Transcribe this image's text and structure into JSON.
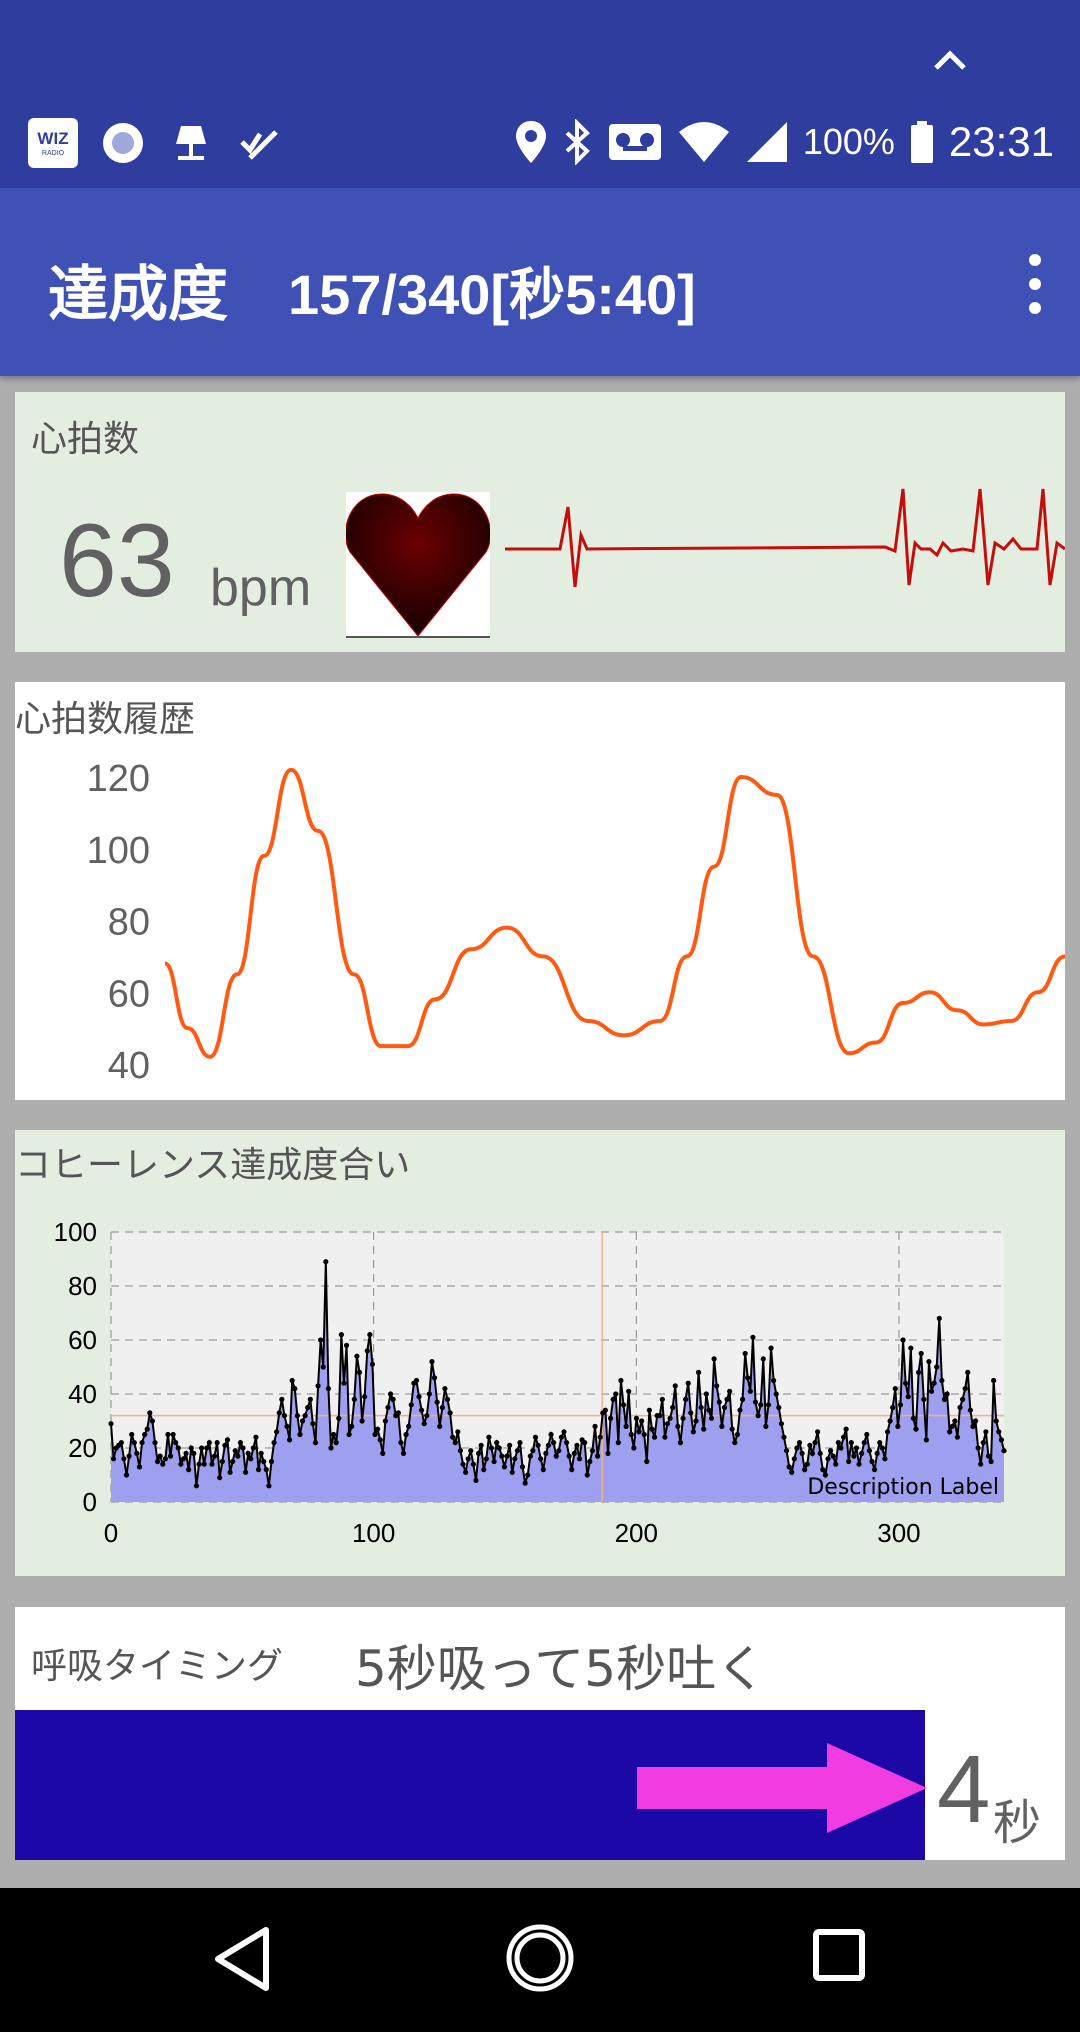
{
  "status_bar": {
    "left_icons": [
      "wiz-radio-icon",
      "record-icon",
      "lamp-icon",
      "checklist-icon"
    ],
    "wiz_label": "WIZ",
    "wiz_sub": "RADIO",
    "right_icons": [
      "location-icon",
      "bluetooth-icon",
      "voicemail-icon",
      "wifi-icon",
      "signal-icon",
      "battery-icon"
    ],
    "battery": "100%",
    "time": "23:31"
  },
  "app_bar": {
    "title": "達成度",
    "progress": "157/340[秒5:40]",
    "menu_icon": "more-vert-icon"
  },
  "heart_rate": {
    "label": "心拍数",
    "value": "63",
    "unit": "bpm"
  },
  "hr_history": {
    "label": "心拍数履歴"
  },
  "coherence": {
    "label": "コヒーレンス達成度合い",
    "description": "Description Label"
  },
  "breathing": {
    "label": "呼吸タイミング",
    "instruction": "5秒吸って5秒吐く",
    "seconds": "4",
    "unit": "秒"
  },
  "nav_bar": {
    "icons": [
      "back-icon",
      "home-icon",
      "recents-icon"
    ]
  },
  "chart_data": [
    {
      "type": "line",
      "series_color": "#ff5a12",
      "y_ticks": [
        120,
        100,
        80,
        60,
        40
      ],
      "ylim": [
        40,
        120
      ],
      "xlim": [
        0,
        100
      ],
      "grid": false,
      "x": [
        0,
        2.5,
        5,
        8,
        11,
        14,
        17,
        21,
        24,
        27,
        30,
        34,
        38,
        42,
        47,
        51,
        55,
        58,
        61,
        64,
        68,
        72,
        76,
        79,
        82,
        85,
        88,
        91,
        94,
        97,
        100
      ],
      "y": [
        68,
        50,
        42,
        65,
        98,
        122,
        105,
        65,
        45,
        45,
        58,
        72,
        78,
        70,
        52,
        48,
        52,
        70,
        95,
        120,
        115,
        70,
        43,
        46,
        57,
        60,
        55,
        51,
        52,
        60,
        70
      ]
    },
    {
      "type": "area",
      "series_color": "#9f9ff0",
      "line_color": "#000000",
      "x_ticks": [
        0,
        100,
        200,
        300
      ],
      "y_ticks": [
        0,
        20,
        40,
        60,
        80,
        100
      ],
      "xlim": [
        0,
        340
      ],
      "ylim": [
        0,
        100
      ],
      "grid": true,
      "reference": {
        "x": 187,
        "y": 32,
        "color": "#f4b183"
      },
      "y": [
        29,
        16,
        20,
        21,
        22,
        16,
        10,
        17,
        25,
        22,
        18,
        13,
        22,
        25,
        27,
        33,
        30,
        22,
        15,
        17,
        14,
        16,
        25,
        17,
        25,
        22,
        20,
        14,
        16,
        18,
        12,
        20,
        18,
        6,
        14,
        20,
        14,
        20,
        22,
        14,
        17,
        22,
        9,
        15,
        21,
        23,
        11,
        15,
        19,
        17,
        22,
        20,
        11,
        18,
        16,
        20,
        24,
        12,
        18,
        15,
        12,
        6,
        15,
        22,
        26,
        33,
        38,
        32,
        28,
        23,
        45,
        42,
        32,
        25,
        30,
        32,
        35,
        38,
        29,
        22,
        43,
        60,
        50,
        89,
        42,
        20,
        25,
        22,
        31,
        62,
        44,
        58,
        25,
        28,
        38,
        54,
        48,
        30,
        39,
        56,
        62,
        51,
        25,
        27,
        23,
        18,
        30,
        35,
        40,
        38,
        32,
        33,
        22,
        18,
        25,
        28,
        36,
        44,
        45,
        39,
        34,
        29,
        32,
        40,
        52,
        46,
        37,
        28,
        35,
        42,
        38,
        33,
        24,
        22,
        26,
        19,
        14,
        11,
        16,
        19,
        14,
        8,
        18,
        21,
        12,
        16,
        24,
        20,
        15,
        22,
        20,
        17,
        13,
        17,
        21,
        11,
        16,
        19,
        22,
        13,
        7,
        10,
        17,
        19,
        24,
        21,
        16,
        12,
        18,
        21,
        25,
        22,
        17,
        19,
        24,
        26,
        22,
        17,
        12,
        18,
        21,
        16,
        23,
        22,
        10,
        15,
        19,
        28,
        17,
        24,
        33,
        34,
        18,
        31,
        38,
        40,
        22,
        45,
        36,
        28,
        41,
        25,
        20,
        31,
        26,
        30,
        25,
        15,
        34,
        27,
        24,
        32,
        32,
        38,
        24,
        29,
        31,
        35,
        43,
        28,
        22,
        31,
        38,
        44,
        33,
        26,
        30,
        48,
        35,
        27,
        40,
        34,
        31,
        53,
        43,
        37,
        28,
        35,
        38,
        41,
        27,
        22,
        25,
        34,
        38,
        55,
        46,
        41,
        61,
        37,
        32,
        36,
        53,
        28,
        36,
        57,
        45,
        40,
        35,
        29,
        24,
        19,
        13,
        11,
        16,
        20,
        22,
        18,
        12,
        14,
        21,
        18,
        22,
        26,
        18,
        12,
        10,
        16,
        19,
        17,
        14,
        22,
        20,
        24,
        27,
        15,
        22,
        17,
        20,
        14,
        18,
        22,
        25,
        19,
        15,
        12,
        18,
        22,
        20,
        16,
        26,
        30,
        35,
        42,
        28,
        36,
        60,
        44,
        39,
        57,
        31,
        27,
        48,
        55,
        38,
        23,
        52,
        41,
        44,
        50,
        68,
        45,
        38,
        40,
        26,
        28,
        30,
        24,
        35,
        38,
        42,
        48,
        34,
        28,
        30,
        20,
        14,
        22,
        26,
        17,
        15,
        45,
        30,
        26,
        23,
        19
      ]
    }
  ]
}
